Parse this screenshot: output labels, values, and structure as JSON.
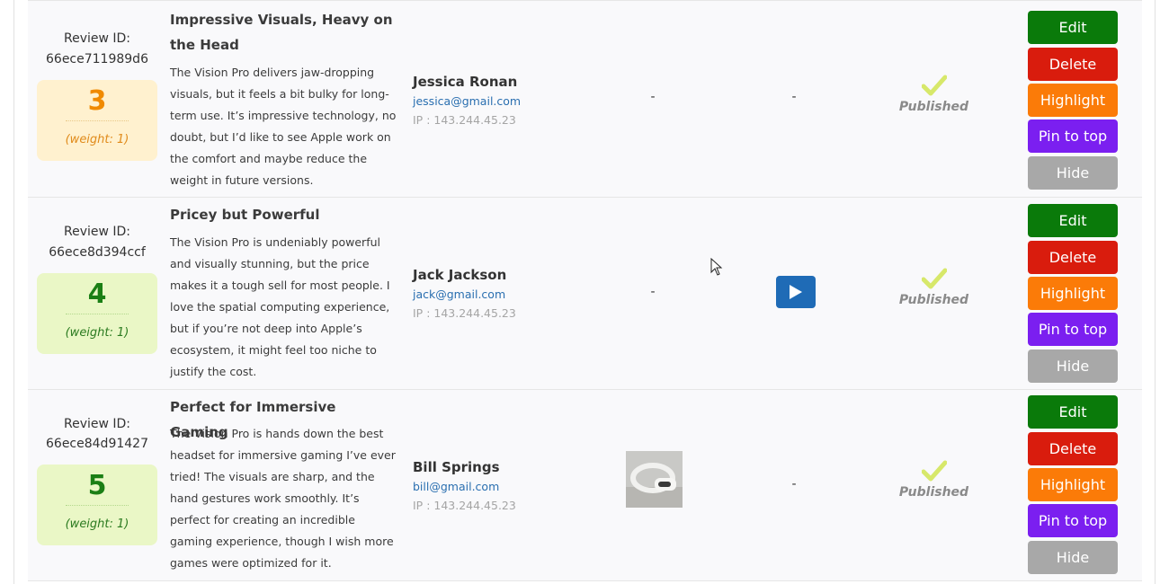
{
  "colors": {
    "edit": "#0a7a0a",
    "delete": "#d91c0d",
    "highlight": "#fb7b08",
    "pin": "#7b1ff0",
    "hide": "#a8a8a8",
    "check": "#d7e86a",
    "play": "#1f6bb6"
  },
  "reviews": [
    {
      "id_label": "Review ID:",
      "id": "66ece711989d6",
      "rating": "3",
      "weight": "(weight: 1)",
      "title": "Impressive Visuals, Heavy on the Head",
      "body": "The Vision Pro delivers jaw-dropping visuals, but it feels a bit bulky for long-term use. It’s impressive technology, no doubt, but I’d like to see Apple work on the comfort and maybe reduce the weight in future versions.",
      "author": "Jessica Ronan",
      "email": "jessica@gmail.com",
      "ip": "IP : 143.244.45.23",
      "media": "-",
      "video": "-",
      "status": "Published",
      "icons": {
        "status": "check-icon"
      }
    },
    {
      "id_label": "Review ID:",
      "id": "66ece8d394ccf",
      "rating": "4",
      "weight": "(weight: 1)",
      "title": "Pricey but Powerful",
      "body": "The Vision Pro is undeniably powerful and visually stunning, but the price makes it a tough sell for most people. I love the spatial computing experience, but if you’re not deep into Apple’s ecosystem, it might feel too niche to justify the cost.",
      "author": "Jack Jackson",
      "email": "jack@gmail.com",
      "ip": "IP : 143.244.45.23",
      "media": "-",
      "video_icon": "play-icon",
      "status": "Published",
      "icons": {
        "status": "check-icon"
      }
    },
    {
      "id_label": "Review ID:",
      "id": "66ece84d91427",
      "rating": "5",
      "weight": "(weight: 1)",
      "title": "Perfect for Immersive Gaming",
      "body": "The Vision Pro is hands down the best headset for immersive gaming I’ve ever tried! The visuals are sharp, and the hand gestures work smoothly. It’s perfect for creating an incredible gaming experience, though I wish more games were optimized for it.",
      "author": "Bill Springs",
      "email": "bill@gmail.com",
      "ip": "IP : 143.244.45.23",
      "media_icon": "headset-thumbnail",
      "video": "-",
      "status": "Published",
      "icons": {
        "status": "check-icon"
      }
    }
  ],
  "actions": {
    "edit": "Edit",
    "delete": "Delete",
    "highlight": "Highlight",
    "pin": "Pin to top",
    "hide": "Hide"
  }
}
